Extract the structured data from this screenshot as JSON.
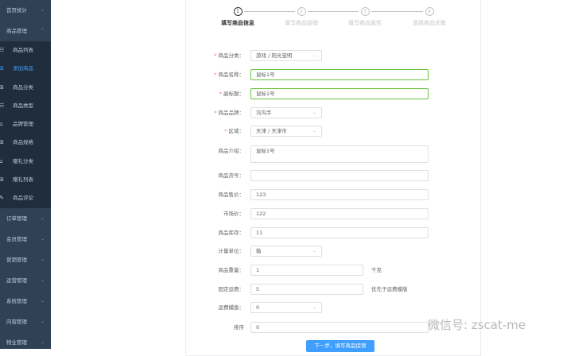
{
  "sidebar": {
    "top": [
      {
        "label": "首页统计"
      },
      {
        "label": "商品管理"
      }
    ],
    "sub": [
      {
        "label": "商品列表",
        "icon": "list-icon"
      },
      {
        "label": "添加商品",
        "icon": "add-icon"
      },
      {
        "label": "商品分类",
        "icon": "grid-icon"
      },
      {
        "label": "商品类型",
        "icon": "list-icon"
      },
      {
        "label": "品牌管理",
        "icon": "tag-icon"
      },
      {
        "label": "商品规格",
        "icon": "grid-icon"
      },
      {
        "label": "赠礼分类",
        "icon": "tag-icon"
      },
      {
        "label": "赠礼列表",
        "icon": "grid-icon"
      },
      {
        "label": "商品评论",
        "icon": "edit-icon"
      }
    ],
    "bottom": [
      {
        "label": "订单管理"
      },
      {
        "label": "会员管理"
      },
      {
        "label": "营销管理"
      },
      {
        "label": "运营管理"
      },
      {
        "label": "系统管理"
      },
      {
        "label": "内容管理"
      },
      {
        "label": "物业管理"
      }
    ]
  },
  "steps": [
    {
      "num": "1",
      "label": "填写商品信息"
    },
    {
      "num": "2",
      "label": "填写商品促销"
    },
    {
      "num": "3",
      "label": "填写商品属性"
    },
    {
      "num": "4",
      "label": "选择商品关联"
    }
  ],
  "form": [
    {
      "label": "商品分类：",
      "value": "游戏 / 阳光宝明",
      "required": true
    },
    {
      "label": "商品名称：",
      "value": "鼠标1号",
      "required": true
    },
    {
      "label": "副标题：",
      "value": "鼠标1号",
      "required": true
    },
    {
      "label": "商品品牌：",
      "value": "沟沟手",
      "required": true
    },
    {
      "label": "区域：",
      "value": "天津 / 天津市",
      "required": true
    },
    {
      "label": "商品介绍：",
      "value": "鼠标1号"
    },
    {
      "label": "商品货号：",
      "value": ""
    },
    {
      "label": "商品售价：",
      "value": "123"
    },
    {
      "label": "市场价：",
      "value": "122"
    },
    {
      "label": "商品库存：",
      "value": "11"
    },
    {
      "label": "计量单位：",
      "value": "箱"
    },
    {
      "label": "商品重量：",
      "value": "1",
      "suffix": "千克"
    },
    {
      "label": "固定运费：",
      "value": "5",
      "suffix": "优先于运费模版"
    },
    {
      "label": "运费模版：",
      "value": "0"
    },
    {
      "label": "排序",
      "value": "0"
    }
  ],
  "next_button": "下一步，填写商品促销",
  "watermark": "微信号: zscat-me"
}
